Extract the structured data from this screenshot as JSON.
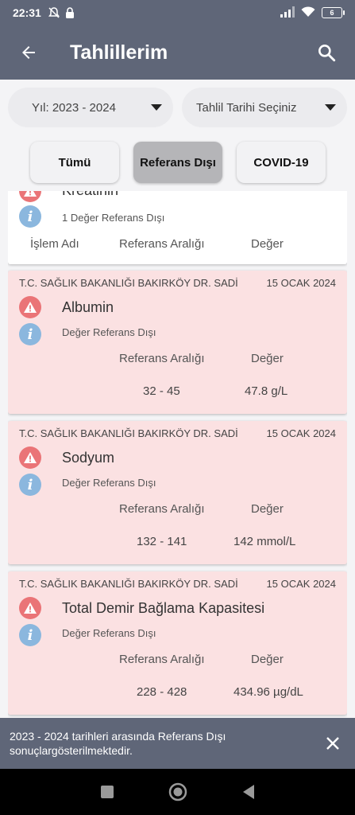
{
  "status": {
    "time": "22:31",
    "battery": "6"
  },
  "appbar": {
    "title": "Tahlillerim"
  },
  "filters": {
    "year": "Yıl: 2023 - 2024",
    "date": "Tahlil Tarihi Seçiniz"
  },
  "tabs": [
    "Tümü",
    "Referans Dışı",
    "COVID-19"
  ],
  "partial_card": {
    "name": "Kreatinin",
    "sub": "1 Değer Referans Dışı",
    "col_name": "İşlem Adı",
    "col_range": "Referans Aralığı",
    "col_value": "Değer"
  },
  "cards": [
    {
      "hospital": "T.C. SAĞLIK BAKANLIĞI BAKIRKÖY DR. SADİ",
      "date": "15 OCAK 2024",
      "name": "Albumin",
      "sub": "Değer Referans Dışı",
      "range_label": "Referans Aralığı",
      "value_label": "Değer",
      "range": "32 - 45",
      "value": "47.8 g/L"
    },
    {
      "hospital": "T.C. SAĞLIK BAKANLIĞI BAKIRKÖY DR. SADİ",
      "date": "15 OCAK 2024",
      "name": "Sodyum",
      "sub": "Değer Referans Dışı",
      "range_label": "Referans Aralığı",
      "value_label": "Değer",
      "range": "132 - 141",
      "value": "142 mmol/L"
    },
    {
      "hospital": "T.C. SAĞLIK BAKANLIĞI BAKIRKÖY DR. SADİ",
      "date": "15 OCAK 2024",
      "name": "Total Demir Bağlama Kapasitesi",
      "sub": "Değer Referans Dışı",
      "range_label": "Referans Aralığı",
      "value_label": "Değer",
      "range": "228 - 428",
      "value": "434.96 µg/dL"
    }
  ],
  "snackbar": {
    "message": "2023 - 2024 tarihleri arasında Referans Dışı sonuçlargösterilmektedir."
  },
  "colors": {
    "appbar": "#5f6678",
    "warning": "#ea7477",
    "info": "#8bb7de",
    "pink_card": "#fbe1e2"
  }
}
